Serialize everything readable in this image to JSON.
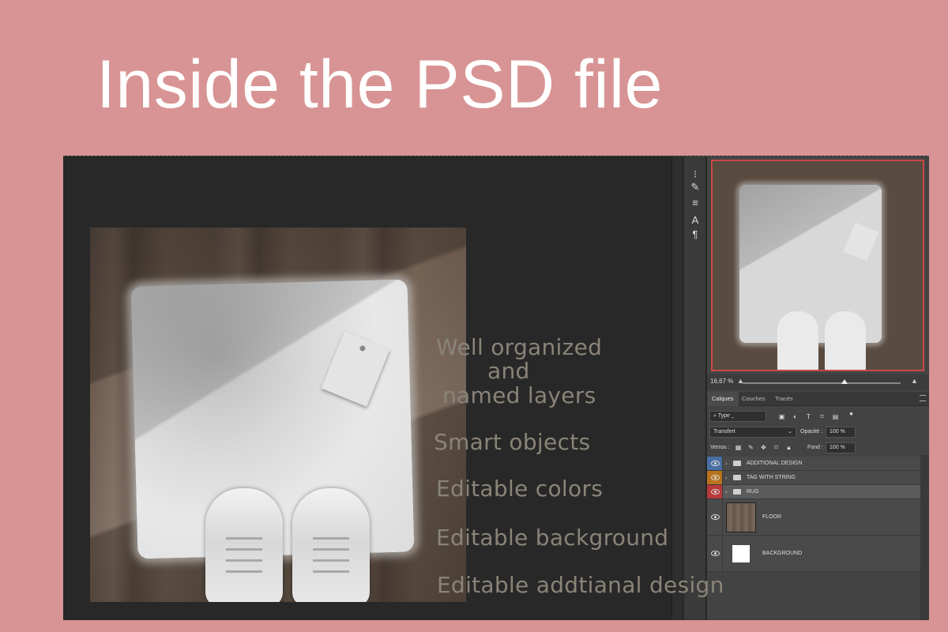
{
  "headline": "Inside the PSD file",
  "features": {
    "well_organized_1": "Well organized",
    "well_organized_2": "and",
    "well_organized_3": "named layers",
    "smart_objects": "Smart objects",
    "editable_colors": "Editable colors",
    "editable_background": "Editable background",
    "editable_design": "Editable addtianal design"
  },
  "navigator": {
    "zoom": "16,67 %"
  },
  "panel_tabs": [
    "Calques",
    "Couches",
    "Tracés"
  ],
  "layer_controls": {
    "filter_type": "Type",
    "blend_mode": "Transfert",
    "opacity_label": "Opacité :",
    "opacity_value": "100 %",
    "lock_label": "Verrou :",
    "fill_label": "Fond :",
    "fill_value": "100 %"
  },
  "layers": [
    {
      "name": "ADDITIONAL DESIGN",
      "type": "group",
      "eye_color": "#4a6fa5"
    },
    {
      "name": "TAG WITH STRING",
      "type": "group",
      "eye_color": "#b8741c"
    },
    {
      "name": "RUG",
      "type": "group",
      "eye_color": "#b83a3a"
    },
    {
      "name": "FLOOR",
      "type": "image"
    },
    {
      "name": "BACKGROUND",
      "type": "image"
    }
  ],
  "tools": [
    "brush-settings-icon",
    "paintbrush-icon",
    "adjustments-icon",
    "character-icon",
    "paragraph-icon"
  ]
}
